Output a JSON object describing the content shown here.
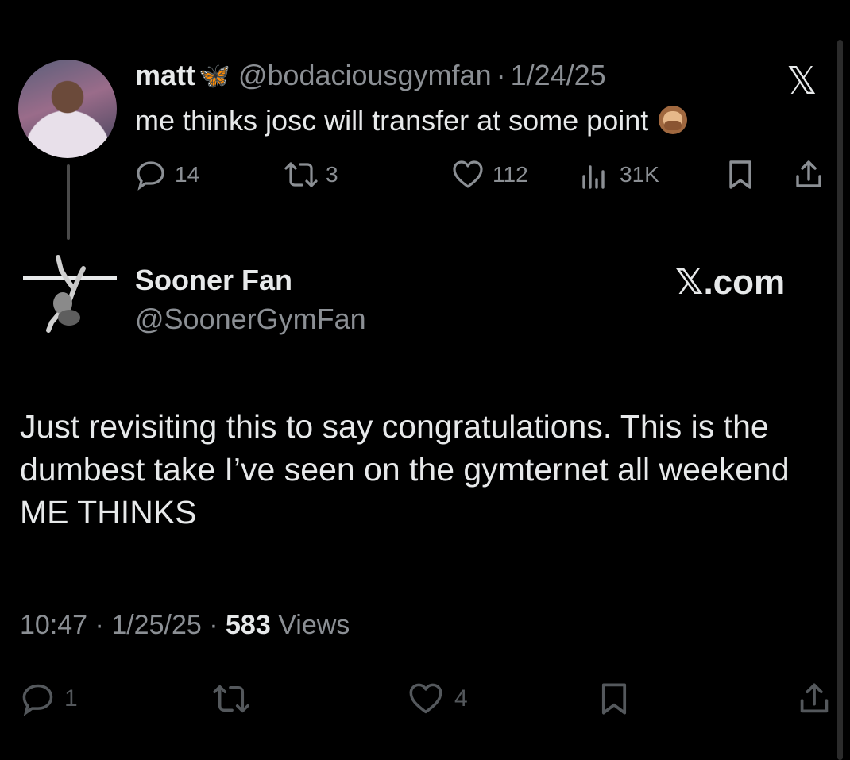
{
  "quoted_tweet": {
    "name": "matt",
    "name_emoji": "🦋",
    "handle": "@bodaciousgymfan",
    "separator": "·",
    "date": "1/24/25",
    "platform_logo": "𝕏",
    "text": "me thinks josc will transfer at some point",
    "text_emoji": "speak-no-evil-monkey",
    "stats": {
      "replies": "14",
      "reposts": "3",
      "likes": "112",
      "views": "31K"
    }
  },
  "main_tweet": {
    "name": "Sooner Fan",
    "handle": "@SoonerGymFan",
    "source_badge": "𝕏.com",
    "text": "Just revisiting this to say congratulations. This is the dumbest take I’ve seen on the gymternet all weekend ME THINKS",
    "time": "10:47",
    "date": "1/25/25",
    "separator": "·",
    "views_count": "583",
    "views_label": "Views",
    "stats": {
      "replies": "1",
      "likes": "4"
    }
  },
  "colors": {
    "background": "#000000",
    "text_primary": "#e7e9ea",
    "text_secondary": "#8b8f94",
    "icon_dim": "#54585c",
    "butterfly": "#7ec8f5"
  }
}
